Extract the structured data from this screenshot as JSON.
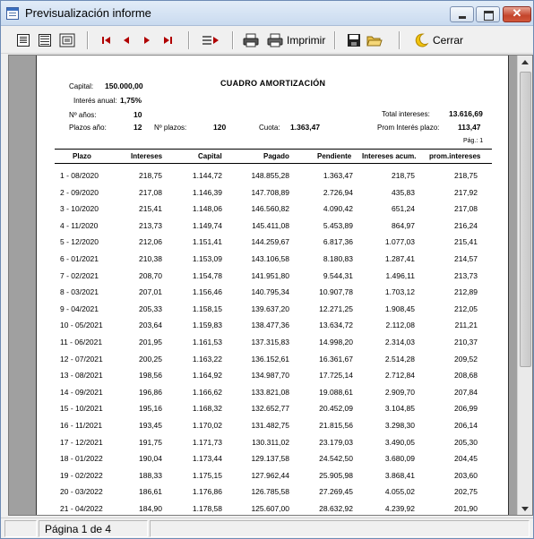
{
  "window": {
    "title": "Previsualización informe"
  },
  "toolbar": {
    "print_label": "Imprimir",
    "close_label": "Cerrar"
  },
  "report": {
    "title": "CUADRO AMORTIZACIÓN",
    "capital_label": "Capital:",
    "capital_value": "150.000,00",
    "interes_label": "Interés anual:",
    "interes_value": "1,75%",
    "anos_label": "Nº años:",
    "anos_value": "10",
    "plazos_ano_label": "Plazos año:",
    "plazos_ano_value": "12",
    "num_plazos_label": "Nº plazos:",
    "num_plazos_value": "120",
    "cuota_label": "Cuota:",
    "cuota_value": "1.363,47",
    "total_intereses_label": "Total intereses:",
    "total_intereses_value": "13.616,69",
    "prom_label": "Prom Interés plazo:",
    "prom_value": "113,47",
    "page_label": "Pág.: 1",
    "columns": [
      "Plazo",
      "Intereses",
      "Capital",
      "Pagado",
      "Pendiente",
      "Intereses acum.",
      "prom.intereses"
    ],
    "rows": [
      [
        "1  -  08/2020",
        "218,75",
        "1.144,72",
        "148.855,28",
        "1.363,47",
        "218,75",
        "218,75"
      ],
      [
        "2  -  09/2020",
        "217,08",
        "1.146,39",
        "147.708,89",
        "2.726,94",
        "435,83",
        "217,92"
      ],
      [
        "3  -  10/2020",
        "215,41",
        "1.148,06",
        "146.560,82",
        "4.090,42",
        "651,24",
        "217,08"
      ],
      [
        "4  -  11/2020",
        "213,73",
        "1.149,74",
        "145.411,08",
        "5.453,89",
        "864,97",
        "216,24"
      ],
      [
        "5  -  12/2020",
        "212,06",
        "1.151,41",
        "144.259,67",
        "6.817,36",
        "1.077,03",
        "215,41"
      ],
      [
        "6  -  01/2021",
        "210,38",
        "1.153,09",
        "143.106,58",
        "8.180,83",
        "1.287,41",
        "214,57"
      ],
      [
        "7  -  02/2021",
        "208,70",
        "1.154,78",
        "141.951,80",
        "9.544,31",
        "1.496,11",
        "213,73"
      ],
      [
        "8  -  03/2021",
        "207,01",
        "1.156,46",
        "140.795,34",
        "10.907,78",
        "1.703,12",
        "212,89"
      ],
      [
        "9  -  04/2021",
        "205,33",
        "1.158,15",
        "139.637,20",
        "12.271,25",
        "1.908,45",
        "212,05"
      ],
      [
        "10  -  05/2021",
        "203,64",
        "1.159,83",
        "138.477,36",
        "13.634,72",
        "2.112,08",
        "211,21"
      ],
      [
        "11  -  06/2021",
        "201,95",
        "1.161,53",
        "137.315,83",
        "14.998,20",
        "2.314,03",
        "210,37"
      ],
      [
        "12  -  07/2021",
        "200,25",
        "1.163,22",
        "136.152,61",
        "16.361,67",
        "2.514,28",
        "209,52"
      ],
      [
        "13  -  08/2021",
        "198,56",
        "1.164,92",
        "134.987,70",
        "17.725,14",
        "2.712,84",
        "208,68"
      ],
      [
        "14  -  09/2021",
        "196,86",
        "1.166,62",
        "133.821,08",
        "19.088,61",
        "2.909,70",
        "207,84"
      ],
      [
        "15  -  10/2021",
        "195,16",
        "1.168,32",
        "132.652,77",
        "20.452,09",
        "3.104,85",
        "206,99"
      ],
      [
        "16  -  11/2021",
        "193,45",
        "1.170,02",
        "131.482,75",
        "21.815,56",
        "3.298,30",
        "206,14"
      ],
      [
        "17  -  12/2021",
        "191,75",
        "1.171,73",
        "130.311,02",
        "23.179,03",
        "3.490,05",
        "205,30"
      ],
      [
        "18  -  01/2022",
        "190,04",
        "1.173,44",
        "129.137,58",
        "24.542,50",
        "3.680,09",
        "204,45"
      ],
      [
        "19  -  02/2022",
        "188,33",
        "1.175,15",
        "127.962,44",
        "25.905,98",
        "3.868,41",
        "203,60"
      ],
      [
        "20  -  03/2022",
        "186,61",
        "1.176,86",
        "126.785,58",
        "27.269,45",
        "4.055,02",
        "202,75"
      ],
      [
        "21  -  04/2022",
        "184,90",
        "1.178,58",
        "125.607,00",
        "28.632,92",
        "4.239,92",
        "201,90"
      ]
    ]
  },
  "status": {
    "page_text": "Página 1 de 4"
  }
}
